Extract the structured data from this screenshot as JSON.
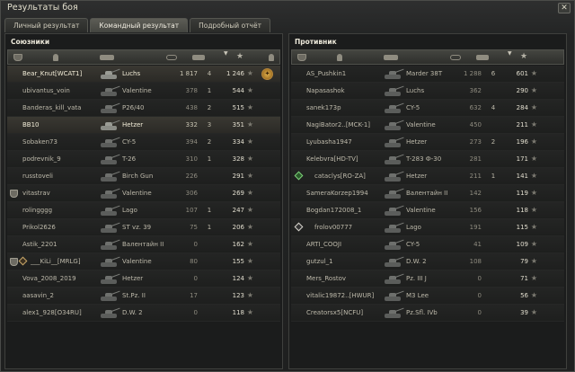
{
  "window": {
    "title": "Результаты боя",
    "close": "✕"
  },
  "tabs": [
    {
      "label": "Личный результат",
      "active": false
    },
    {
      "label": "Командный результат",
      "active": true
    },
    {
      "label": "Подробный отчёт",
      "active": false
    }
  ],
  "allies": {
    "title": "Союзники",
    "rows": [
      {
        "name": "Bear_Knut[WCAT1]",
        "vehicle": "Luchs",
        "damage": "1 817",
        "frags": "4",
        "xp": "1 246",
        "me": true,
        "rank_badge": true
      },
      {
        "name": "ubivantus_voin",
        "vehicle": "Valentine",
        "damage": "378",
        "frags": "1",
        "xp": "544"
      },
      {
        "name": "Banderas_kill_vata",
        "vehicle": "P26/40",
        "damage": "438",
        "frags": "2",
        "xp": "515"
      },
      {
        "name": "BB10",
        "vehicle": "Hetzer",
        "damage": "332",
        "frags": "3",
        "xp": "351",
        "me": true
      },
      {
        "name": "Sobaken73",
        "vehicle": "CY-5",
        "damage": "394",
        "frags": "2",
        "xp": "334"
      },
      {
        "name": "podrevnik_9",
        "vehicle": "T-26",
        "damage": "310",
        "frags": "1",
        "xp": "328"
      },
      {
        "name": "russtoveli",
        "vehicle": "Birch Gun",
        "damage": "226",
        "frags": "",
        "xp": "291"
      },
      {
        "name": "vitastrav",
        "vehicle": "Valentine",
        "damage": "306",
        "frags": "",
        "xp": "269",
        "clan": "shield"
      },
      {
        "name": "rolingggg",
        "vehicle": "Lago",
        "damage": "107",
        "frags": "1",
        "xp": "247"
      },
      {
        "name": "Prikol2626",
        "vehicle": "ST vz. 39",
        "damage": "75",
        "frags": "1",
        "xp": "206"
      },
      {
        "name": "Astik_2201",
        "vehicle": "Валентайн II",
        "damage": "0",
        "frags": "",
        "xp": "162"
      },
      {
        "name": "___KiLi__[MRLG]",
        "vehicle": "Valentine",
        "damage": "80",
        "frags": "",
        "xp": "155",
        "clan": "shield-diamond"
      },
      {
        "name": "Vova_2008_2019",
        "vehicle": "Hetzer",
        "damage": "0",
        "frags": "",
        "xp": "124"
      },
      {
        "name": "aasavin_2",
        "vehicle": "St.Pz. II",
        "damage": "17",
        "frags": "",
        "xp": "123"
      },
      {
        "name": "alex1_928[O34RU]",
        "vehicle": "D.W. 2",
        "damage": "0",
        "frags": "",
        "xp": "118"
      }
    ]
  },
  "enemies": {
    "title": "Противник",
    "rows": [
      {
        "name": "AS_Pushkin1",
        "vehicle": "Marder 38T",
        "damage": "1 288",
        "frags": "6",
        "xp": "601"
      },
      {
        "name": "Napasashok",
        "vehicle": "Luchs",
        "damage": "362",
        "frags": "",
        "xp": "290"
      },
      {
        "name": "sanek173p",
        "vehicle": "CY-5",
        "damage": "632",
        "frags": "4",
        "xp": "284"
      },
      {
        "name": "NagiBator2..[MCK-1]",
        "vehicle": "Valentine",
        "damage": "450",
        "frags": "",
        "xp": "211"
      },
      {
        "name": "Lyubasha1947",
        "vehicle": "Hetzer",
        "damage": "273",
        "frags": "2",
        "xp": "196"
      },
      {
        "name": "Kelebvra[HD-TV]",
        "vehicle": "T-283 Ф-30",
        "damage": "281",
        "frags": "",
        "xp": "171"
      },
      {
        "name": "cataclys[RO-ZA]",
        "vehicle": "Hetzer",
        "damage": "211",
        "frags": "1",
        "xp": "141",
        "clan": "diamond-green"
      },
      {
        "name": "SameraKorzep1994",
        "vehicle": "Валентайн II",
        "damage": "142",
        "frags": "",
        "xp": "119"
      },
      {
        "name": "Bogdan172008_1",
        "vehicle": "Valentine",
        "damage": "156",
        "frags": "",
        "xp": "118"
      },
      {
        "name": "frolov00777",
        "vehicle": "Lago",
        "damage": "191",
        "frags": "",
        "xp": "115",
        "clan": "diamond-white"
      },
      {
        "name": "ARTI_COOJI",
        "vehicle": "CY-5",
        "damage": "41",
        "frags": "",
        "xp": "109"
      },
      {
        "name": "gutzul_1",
        "vehicle": "D.W. 2",
        "damage": "108",
        "frags": "",
        "xp": "79"
      },
      {
        "name": "Mers_Rostov",
        "vehicle": "Pz. III J",
        "damage": "0",
        "frags": "",
        "xp": "71"
      },
      {
        "name": "vitalic19872..[HWUR]",
        "vehicle": "M3 Lee",
        "damage": "0",
        "frags": "",
        "xp": "56"
      },
      {
        "name": "Creatorsx5[NCFU]",
        "vehicle": "Pz.Sfl. IVb",
        "damage": "0",
        "frags": "",
        "xp": "39"
      }
    ]
  },
  "icons": {
    "star": "★",
    "sort_arrow": "▼",
    "rank_badge": "✦"
  }
}
